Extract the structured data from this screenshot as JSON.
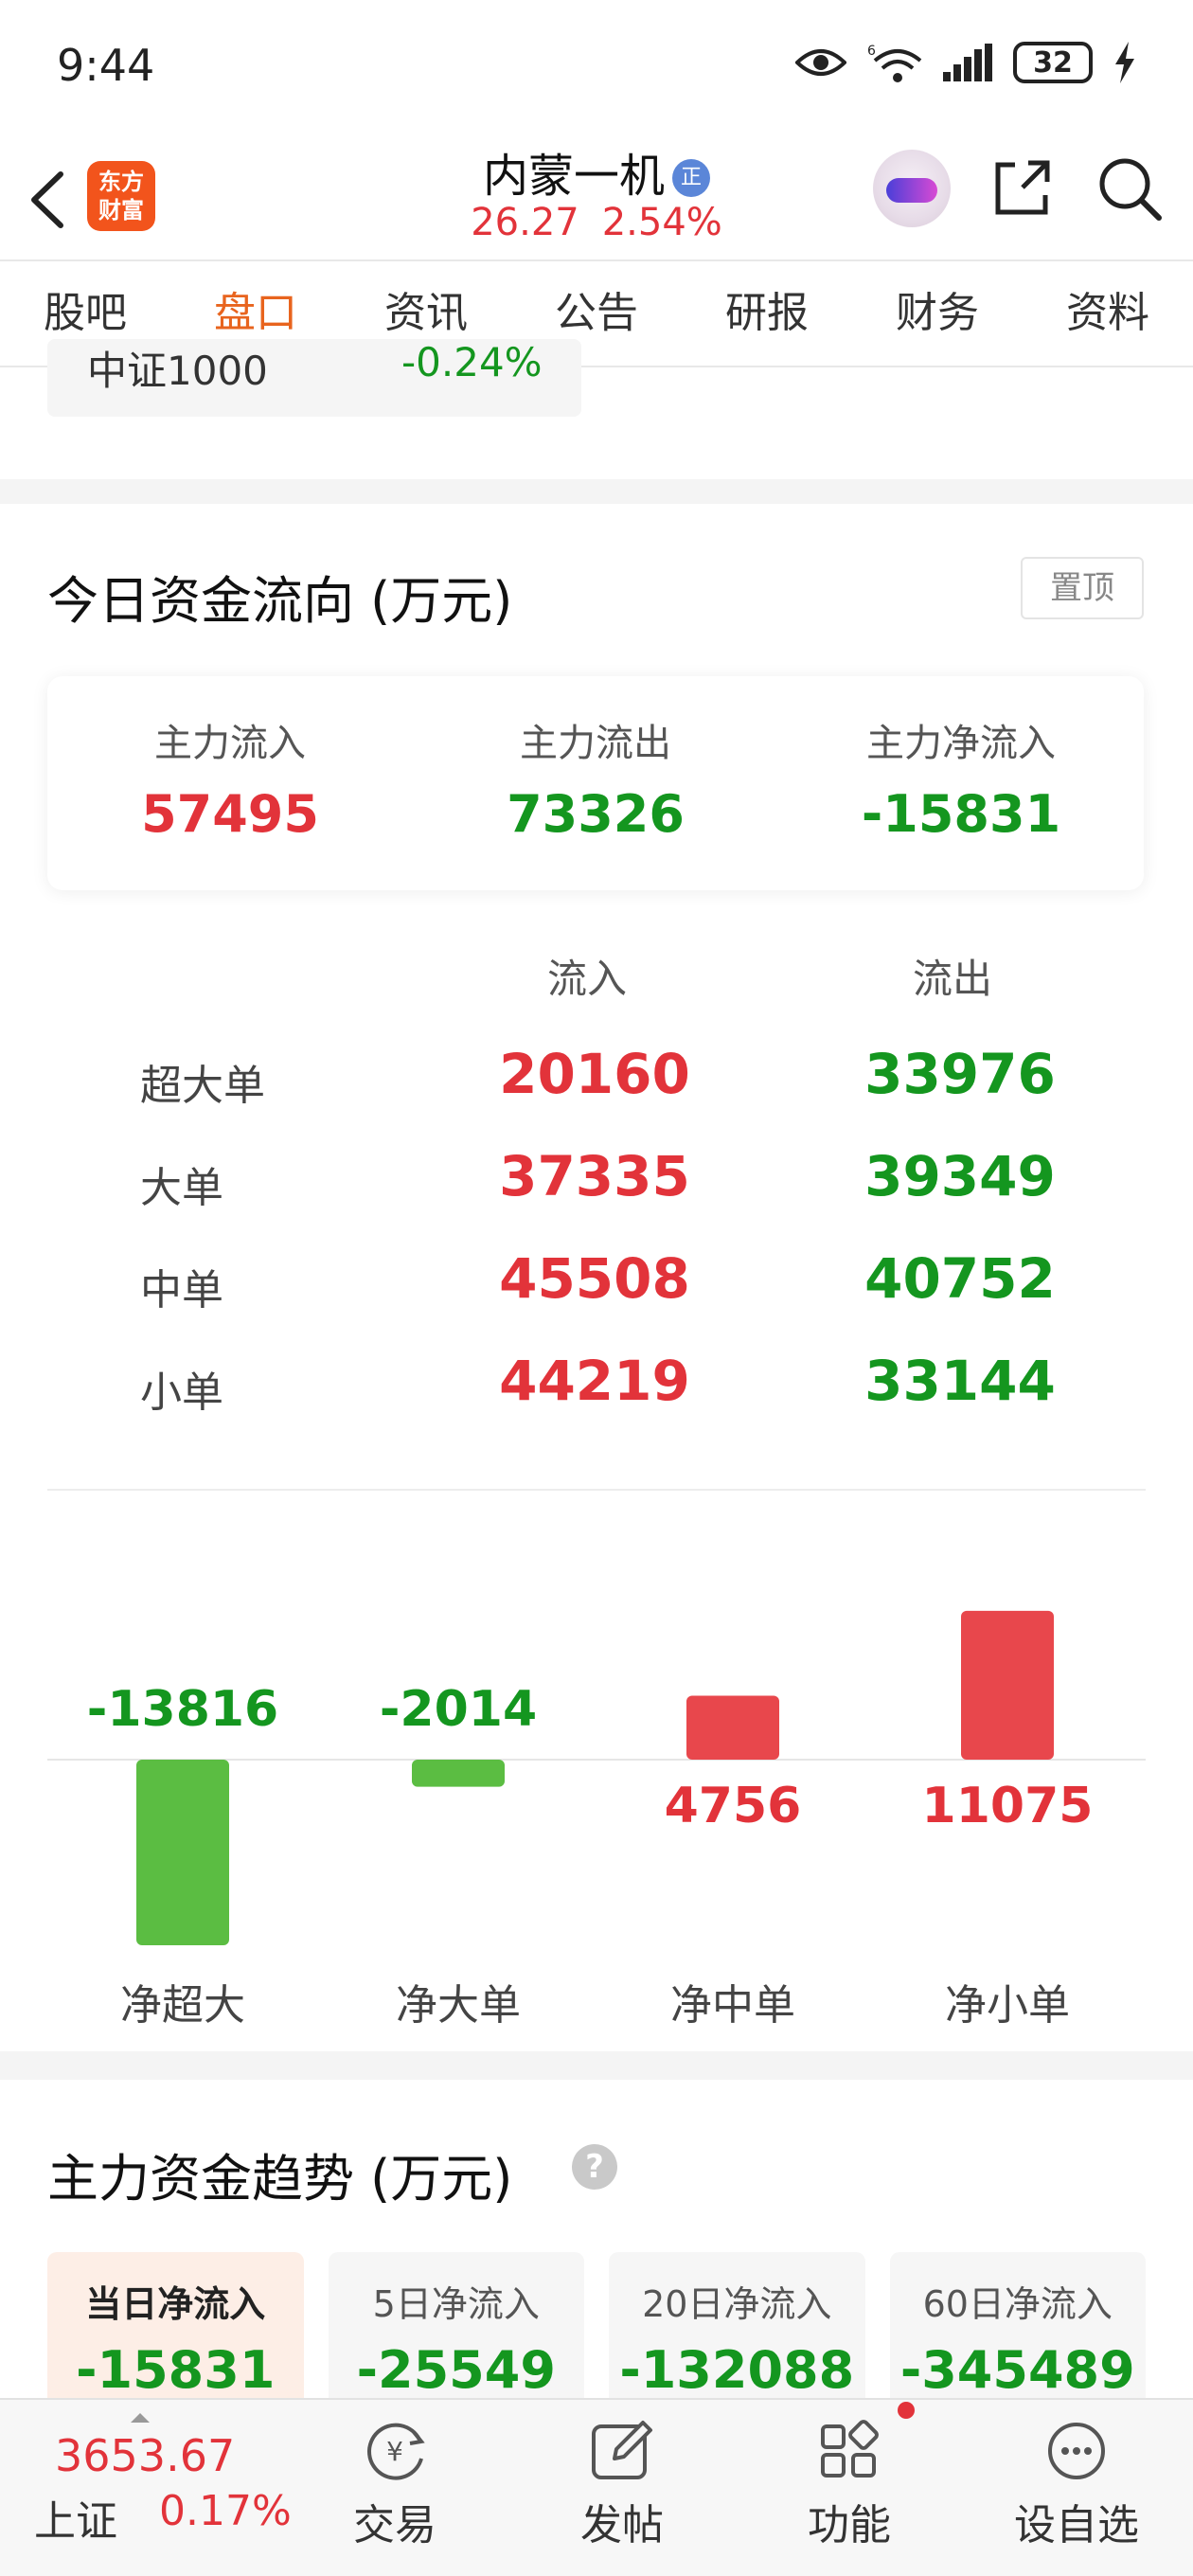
{
  "status_bar": {
    "time": "9:44",
    "signal_label": "6",
    "battery": "32"
  },
  "header": {
    "logo_line1": "东方",
    "logo_line2": "财富",
    "stock_name": "内蒙一机",
    "stock_badge": "正",
    "price": "26.27",
    "change_pct": "2.54%"
  },
  "tabs": [
    {
      "label": "股吧",
      "active": false
    },
    {
      "label": "盘口",
      "active": true
    },
    {
      "label": "资讯",
      "active": false
    },
    {
      "label": "公告",
      "active": false
    },
    {
      "label": "研报",
      "active": false
    },
    {
      "label": "财务",
      "active": false
    },
    {
      "label": "资料",
      "active": false
    }
  ],
  "top_index": {
    "name": "中证1000",
    "value": "-0.24%"
  },
  "fund_flow": {
    "title": "今日资金流向 (万元)",
    "pin_label": "置顶",
    "summary": [
      {
        "label": "主力流入",
        "value": "57495",
        "color": "#e2333a"
      },
      {
        "label": "主力流出",
        "value": "73326",
        "color": "#14961f"
      },
      {
        "label": "主力净流入",
        "value": "-15831",
        "color": "#14961f"
      }
    ],
    "table_headers": {
      "in": "流入",
      "out": "流出"
    },
    "rows": [
      {
        "label": "超大单",
        "in": "20160",
        "out": "33976"
      },
      {
        "label": "大单",
        "in": "37335",
        "out": "39349"
      },
      {
        "label": "中单",
        "in": "45508",
        "out": "40752"
      },
      {
        "label": "小单",
        "in": "44219",
        "out": "33144"
      }
    ]
  },
  "chart_data": {
    "type": "bar",
    "title": "",
    "categories": [
      "净超大",
      "净大单",
      "净中单",
      "净小单"
    ],
    "values": [
      -13816,
      -2014,
      4756,
      11075
    ],
    "value_labels": [
      "-13816",
      "-2014",
      "4756",
      "11075"
    ],
    "positive_color": "#e8474c",
    "negative_color": "#5bbd42",
    "grid": false
  },
  "trend": {
    "title": "主力资金趋势 (万元)",
    "help": "?",
    "cards": [
      {
        "label": "当日净流入",
        "value": "-15831",
        "active": true
      },
      {
        "label": "5日净流入",
        "value": "-25549",
        "active": false
      },
      {
        "label": "20日净流入",
        "value": "-132088",
        "active": false
      },
      {
        "label": "60日净流入",
        "value": "-345489",
        "active": false
      }
    ]
  },
  "bottom_nav": {
    "index_price": "3653.67",
    "index_name": "上证",
    "index_pct": "0.17%",
    "items": [
      {
        "label": "交易",
        "icon": "trade-icon"
      },
      {
        "label": "发帖",
        "icon": "post-icon"
      },
      {
        "label": "功能",
        "icon": "function-grid-icon"
      },
      {
        "label": "设自选",
        "icon": "watchlist-icon"
      }
    ]
  }
}
